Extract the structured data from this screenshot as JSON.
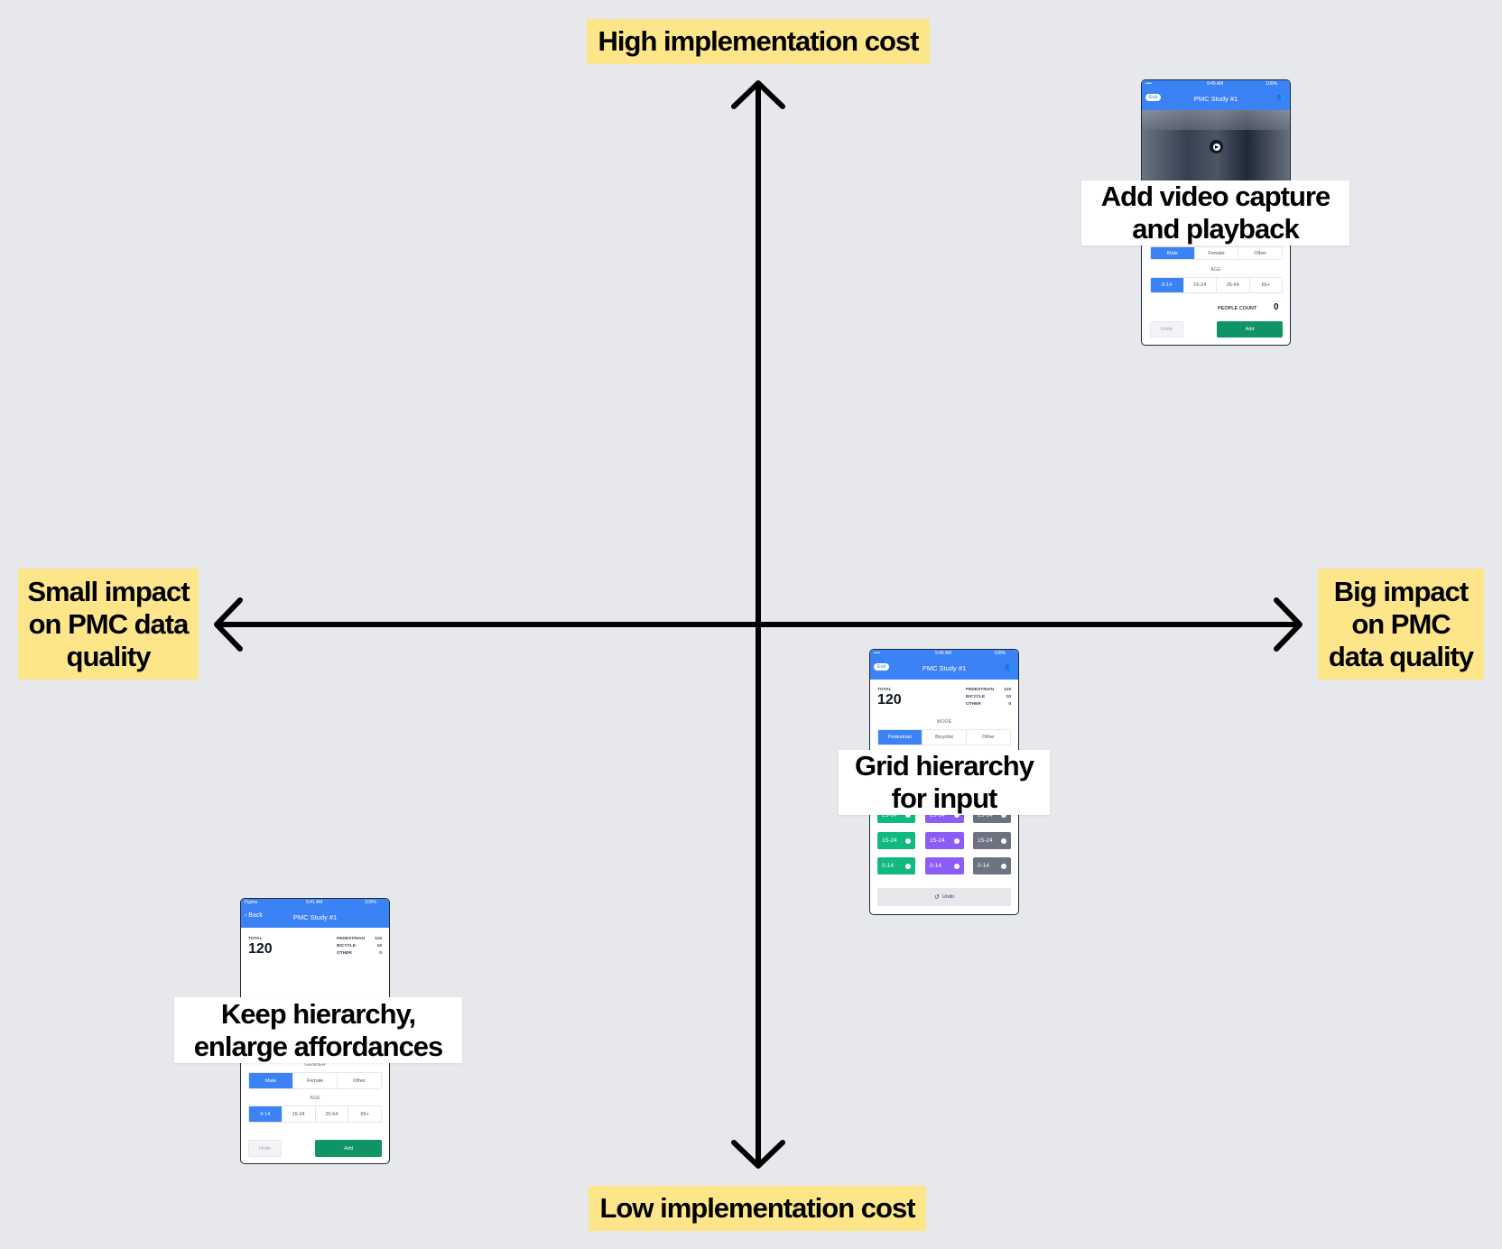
{
  "axes": {
    "top": "High implementation cost",
    "bottom": "Low implementation cost",
    "left": "Small impact on PMC data quality",
    "right": "Big impact on PMC data quality"
  },
  "colors": {
    "background": "#e7e8ec",
    "axis_label_bg": "#fde68a",
    "primary": "#3b82f6",
    "add": "#0f9466",
    "green": "#10b981",
    "purple": "#8b5cf6",
    "gray": "#6b7280"
  },
  "ideas": [
    {
      "label": "Add video capture and playback",
      "phone": {
        "carrier": "•••• ",
        "time": "9:45 AM",
        "battery": "100%",
        "exit": "Exit",
        "title": "PMC Study #1",
        "icon": "users-icon",
        "play_icon": "play-icon",
        "gender": [
          "Male",
          "Female",
          "Other"
        ],
        "age_label": "AGE",
        "age": [
          "0-14",
          "15-24",
          "25-64",
          "65+"
        ],
        "people_count_label": "PEOPLE COUNT",
        "people_count": "0",
        "undo": "Undo",
        "add": "Add"
      }
    },
    {
      "label": "Grid hierarchy for input",
      "phone": {
        "carrier": "•••• ",
        "time": "9:45 AM",
        "battery": "100%",
        "exit": "Exit",
        "title": "PMC Study #1",
        "total_label": "TOTAL",
        "total": "120",
        "stats": [
          {
            "k": "PEDESTRIAN",
            "v": "110"
          },
          {
            "k": "BICYCLE",
            "v": "10"
          },
          {
            "k": "OTHER",
            "v": "0"
          }
        ],
        "mode_label": "MODE",
        "mode": [
          "Pedestrian",
          "Bicyclist",
          "Other"
        ],
        "grid_rows": [
          [
            "25-64",
            "25-64",
            "25-64"
          ],
          [
            "15-24",
            "15-24",
            "15-24"
          ],
          [
            "0-14",
            "0-14",
            "0-14"
          ]
        ],
        "undo": "Undo"
      }
    },
    {
      "label": "Keep hierarchy, enlarge affordances",
      "phone": {
        "carrier": "Figma",
        "time": "9:41 AM",
        "battery": "100%",
        "back": "Back",
        "title": "PMC Study #1",
        "total_label": "TOTAL",
        "total": "120",
        "stats": [
          {
            "k": "PEDESTRIAN",
            "v": "110"
          },
          {
            "k": "BICYCLE",
            "v": "10"
          },
          {
            "k": "OTHER",
            "v": "0"
          }
        ],
        "gender_label": "GENDER",
        "gender": [
          "Male",
          "Female",
          "Other"
        ],
        "age_label": "AGE",
        "age": [
          "0-14",
          "15-24",
          "25-64",
          "65+"
        ],
        "undo": "Undo",
        "add": "Add"
      }
    }
  ]
}
